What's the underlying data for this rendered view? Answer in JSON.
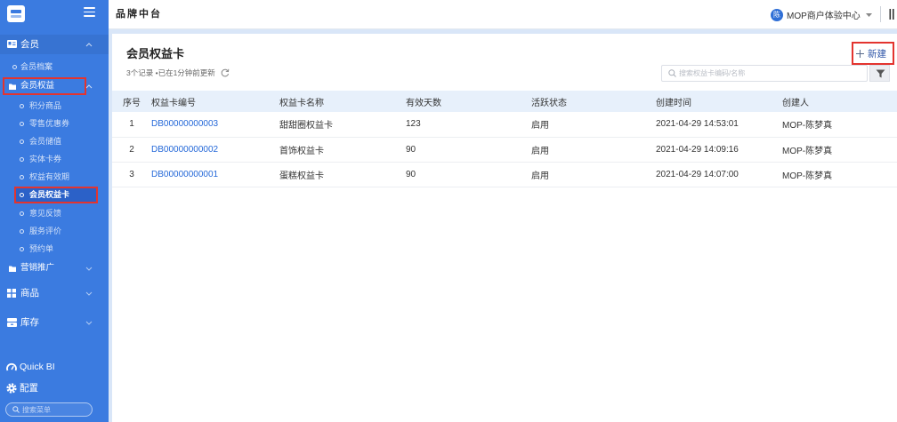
{
  "colors": {
    "sidebar_bg": "#3b7be0",
    "sidebar_active_bg": "#2b61c8",
    "accent": "#2f6fd6",
    "link": "#2468d8",
    "table_header_bg": "#e7f0fb",
    "content_bg": "#d9e6f8",
    "annotation": "#e3342f"
  },
  "header": {
    "title": "品牌中台",
    "avatar_text": "陈",
    "org_name": "MOP商户体验中心",
    "dropdown_icon": "chevron-down-icon",
    "action_icon": "header-menu-icon"
  },
  "sidebar": {
    "logo_icon": "brand-logo",
    "menu_icon": "hamburger-icon",
    "member": {
      "label": "会员",
      "icon": "member-card-icon",
      "archive": {
        "label": "会员档案"
      },
      "benefits": {
        "label": "会员权益",
        "icon": "folder-icon",
        "children": [
          {
            "label": "积分商品"
          },
          {
            "label": "零售优惠券"
          },
          {
            "label": "会员储值"
          },
          {
            "label": "实体卡券"
          },
          {
            "label": "权益有效期"
          },
          {
            "label": "会员权益卡",
            "selected": true
          },
          {
            "label": "意见反馈"
          },
          {
            "label": "服务评价"
          },
          {
            "label": "预约单"
          }
        ]
      },
      "marketing": {
        "label": "营销推广",
        "icon": "folder-icon"
      }
    },
    "goods": {
      "label": "商品",
      "icon": "grid-icon"
    },
    "inventory": {
      "label": "库存",
      "icon": "inventory-icon"
    },
    "quick_bi": {
      "label": "Quick BI",
      "icon": "gauge-icon"
    },
    "config": {
      "label": "配置",
      "icon": "gear-icon"
    },
    "search": {
      "placeholder": "搜索菜单"
    }
  },
  "page": {
    "title": "会员权益卡",
    "meta": "3个记录 •已在1分钟前更新",
    "new_button": "新建",
    "search_placeholder": "搜索权益卡编码/名称"
  },
  "table": {
    "columns": [
      "序号",
      "权益卡编号",
      "权益卡名称",
      "有效天数",
      "活跃状态",
      "创建时间",
      "创建人"
    ],
    "rows": [
      {
        "index": "1",
        "code": "DB00000000003",
        "name": "甜甜圈权益卡",
        "valid_days": "123",
        "status": "启用",
        "created_at": "2021-04-29 14:53:01",
        "creator": "MOP-陈梦真"
      },
      {
        "index": "2",
        "code": "DB00000000002",
        "name": "首饰权益卡",
        "valid_days": "90",
        "status": "启用",
        "created_at": "2021-04-29 14:09:16",
        "creator": "MOP-陈梦真"
      },
      {
        "index": "3",
        "code": "DB00000000001",
        "name": "蛋糕权益卡",
        "valid_days": "90",
        "status": "启用",
        "created_at": "2021-04-29 14:07:00",
        "creator": "MOP-陈梦真"
      }
    ]
  }
}
